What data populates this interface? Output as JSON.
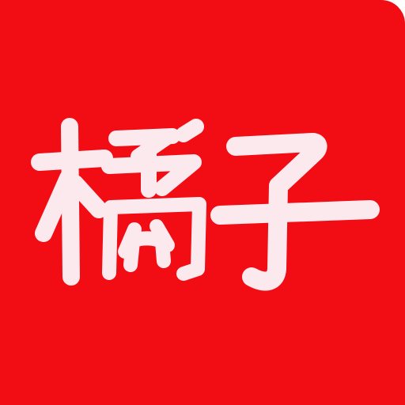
{
  "logo": {
    "text": "橘子",
    "background_color": "#f20d14",
    "glyph_color": "#fbe9ee",
    "icon": "orange-app-logo-icon"
  }
}
